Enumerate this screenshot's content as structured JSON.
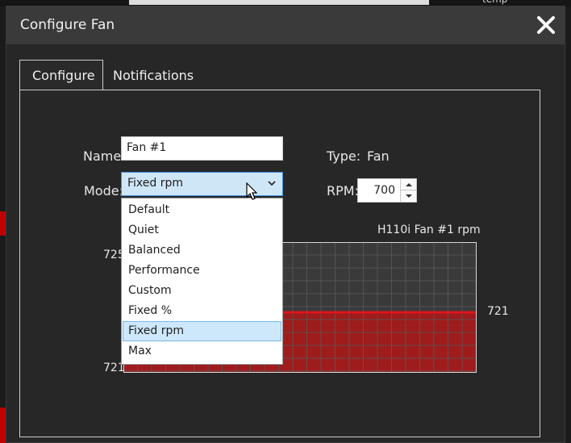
{
  "background": {
    "temp_fragment": "temp"
  },
  "dialog": {
    "title": "Configure Fan",
    "close_icon": "close-icon"
  },
  "tabs": [
    {
      "label": "Configure",
      "active": true
    },
    {
      "label": "Notifications",
      "active": false
    }
  ],
  "form": {
    "name_label": "Name:",
    "name_value": "Fan #1",
    "type_label": "Type:",
    "type_value": "Fan",
    "mode_label": "Mode:",
    "mode_value": "Fixed rpm",
    "rpm_label": "RPM:",
    "rpm_value": "700"
  },
  "mode_options": [
    "Default",
    "Quiet",
    "Balanced",
    "Performance",
    "Custom",
    "Fixed %",
    "Fixed rpm",
    "Max"
  ],
  "mode_selected_index": 6,
  "chart_data": {
    "type": "area",
    "title": "H110i  Fan #1 rpm",
    "ylim": [
      721,
      725
    ],
    "y_tick_labels": [
      "725",
      "721"
    ],
    "current_value_label": "721",
    "series": [
      {
        "values": [
          721,
          721,
          721,
          721,
          721,
          721,
          721,
          721,
          721,
          721,
          721,
          721,
          721,
          721,
          721,
          721,
          721,
          721,
          721,
          721,
          721,
          721,
          721
        ]
      }
    ],
    "grid": true,
    "colors": {
      "fill": "#9e1c1c",
      "line": "#e0141e",
      "grid_bg": "#3a3a3a",
      "grid_line": "#5a5a5a"
    }
  }
}
